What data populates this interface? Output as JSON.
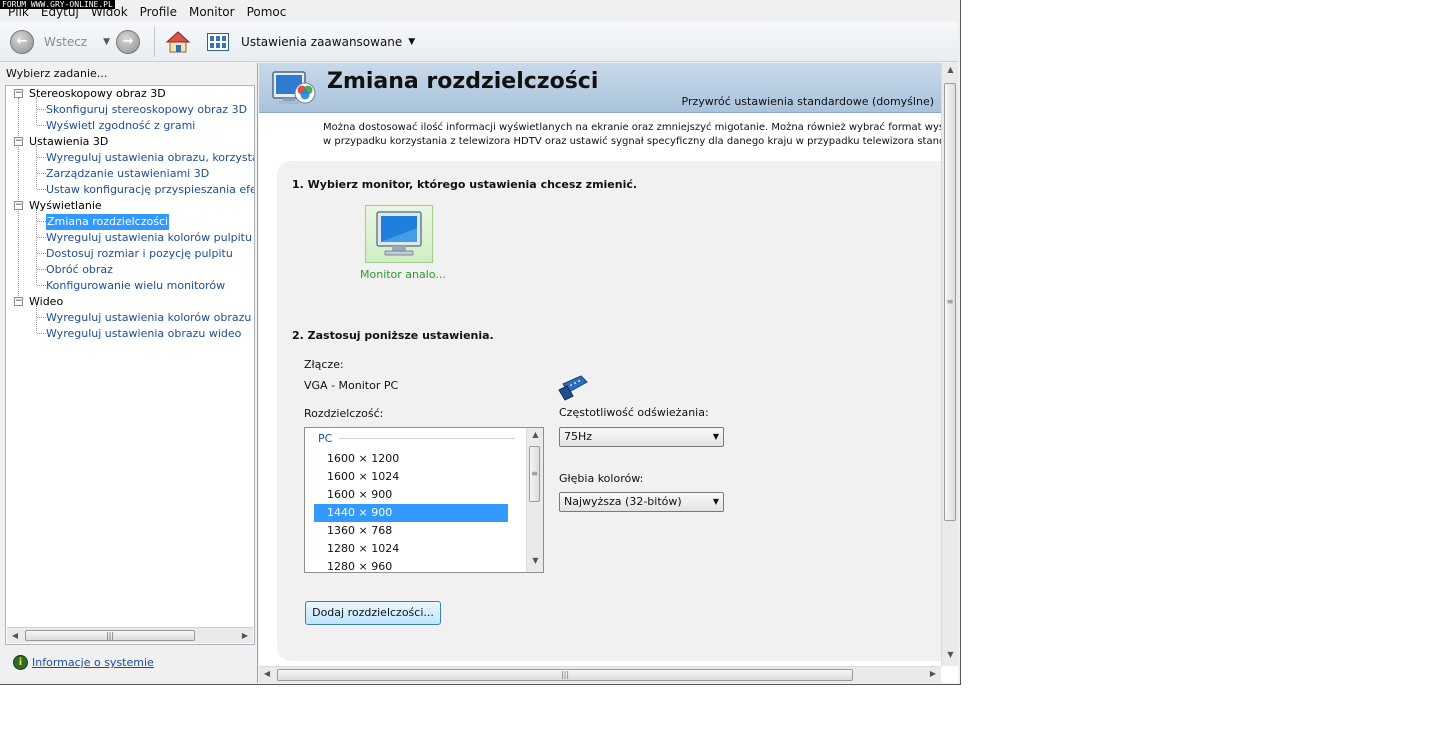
{
  "watermark": "FORUM WWW.GRY-ONLINE.PL",
  "menu": [
    "Plik",
    "Edytuj",
    "Widok",
    "Profile",
    "Monitor",
    "Pomoc"
  ],
  "toolbar": {
    "back_label": "Wstecz",
    "advanced_label": "Ustawienia zaawansowane",
    "icons": [
      "back-arrow-icon",
      "forward-arrow-icon",
      "home-icon",
      "grid-view-icon"
    ]
  },
  "sidebar": {
    "header": "Wybierz zadanie...",
    "tree": [
      {
        "label": "Stereoskopowy obraz 3D",
        "children": [
          "Skonfiguruj stereoskopowy obraz 3D",
          "Wyświetl zgodność z grami"
        ]
      },
      {
        "label": "Ustawienia 3D",
        "children": [
          "Wyreguluj ustawienia obrazu, korzystając z",
          "Zarządzanie ustawieniami 3D",
          "Ustaw konfigurację przyspieszania efektów"
        ]
      },
      {
        "label": "Wyświetlanie",
        "children": [
          "Zmiana rozdzielczości",
          "Wyreguluj ustawienia kolorów pulpitu",
          "Dostosuj rozmiar i pozycję pulpitu",
          "Obróć obraz",
          "Konfigurowanie wielu monitorów"
        ]
      },
      {
        "label": "Wideo",
        "children": [
          "Wyreguluj ustawienia kolorów obrazu wideo",
          "Wyreguluj ustawienia obrazu wideo"
        ]
      }
    ],
    "selected": "Zmiana rozdzielczości",
    "system_info_link": "Informacje o systemie"
  },
  "main": {
    "title": "Zmiana rozdzielczości",
    "restore_link": "Przywróć ustawienia standardowe (domyślne)",
    "description_line1": "Można dostosować ilość informacji wyświetlanych na ekranie oraz zmniejszyć migotanie. Można również wybrać format wysokiej rozdzielczości",
    "description_line2": "w przypadku korzystania z telewizora HDTV oraz ustawić sygnał specyficzny dla danego kraju w przypadku telewizora standardowego.",
    "section1": "1. Wybierz monitor, którego ustawienia chcesz zmienić.",
    "monitor_label": "Monitor analo...",
    "section2": "2. Zastosuj poniższe ustawienia.",
    "connector_label": "Złącze:",
    "connector_value": "VGA - Monitor PC",
    "resolution_label": "Rozdzielczość:",
    "resolution_group": "PC",
    "resolutions": [
      "1600 × 1200",
      "1600 × 1024",
      "1600 × 900",
      "1440 × 900",
      "1360 × 768",
      "1280 × 1024",
      "1280 × 960"
    ],
    "selected_resolution": "1440 × 900",
    "refresh_label": "Częstotliwość odświeżania:",
    "refresh_value": "75Hz",
    "color_depth_label": "Głębia kolorów:",
    "color_depth_value": "Najwyższa (32-bitów)",
    "add_resolution_button": "Dodaj rozdzielczości..."
  }
}
